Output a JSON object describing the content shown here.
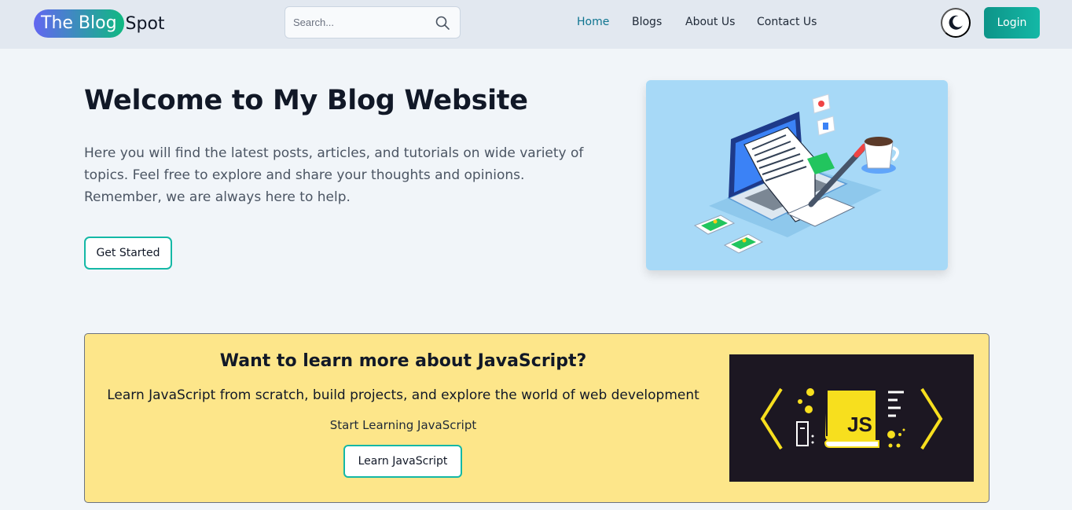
{
  "navbar": {
    "logo_highlight": "The Blog",
    "logo_rest": "Spot",
    "search_placeholder": "Search...",
    "links": [
      {
        "label": "Home",
        "active": true
      },
      {
        "label": "Blogs",
        "active": false
      },
      {
        "label": "About Us",
        "active": false
      },
      {
        "label": "Contact Us",
        "active": false
      }
    ],
    "theme_icon": "moon-icon",
    "login_label": "Login"
  },
  "hero": {
    "title": "Welcome to My Blog Website",
    "description": "Here you will find the latest posts, articles, and tutorials on wide variety of topics. Feel free to explore and share your thoughts and opinions. Remember, we are always here to help.",
    "cta_label": "Get Started",
    "illustration": "laptop-blog-illustration"
  },
  "js_banner": {
    "title": "Want to learn more about JavaScript?",
    "description": "Learn JavaScript from scratch, build projects, and explore the world of web development",
    "subtitle": "Start Learning JavaScript",
    "button_label": "Learn JavaScript",
    "image_text": "JS"
  },
  "colors": {
    "accent": "#14b8a6",
    "nav_active": "#0e7490",
    "navbar_bg": "#e2e8f0",
    "page_bg": "#f1f5f9",
    "banner_bg": "#fde68a",
    "js_yellow": "#f7df1e"
  }
}
